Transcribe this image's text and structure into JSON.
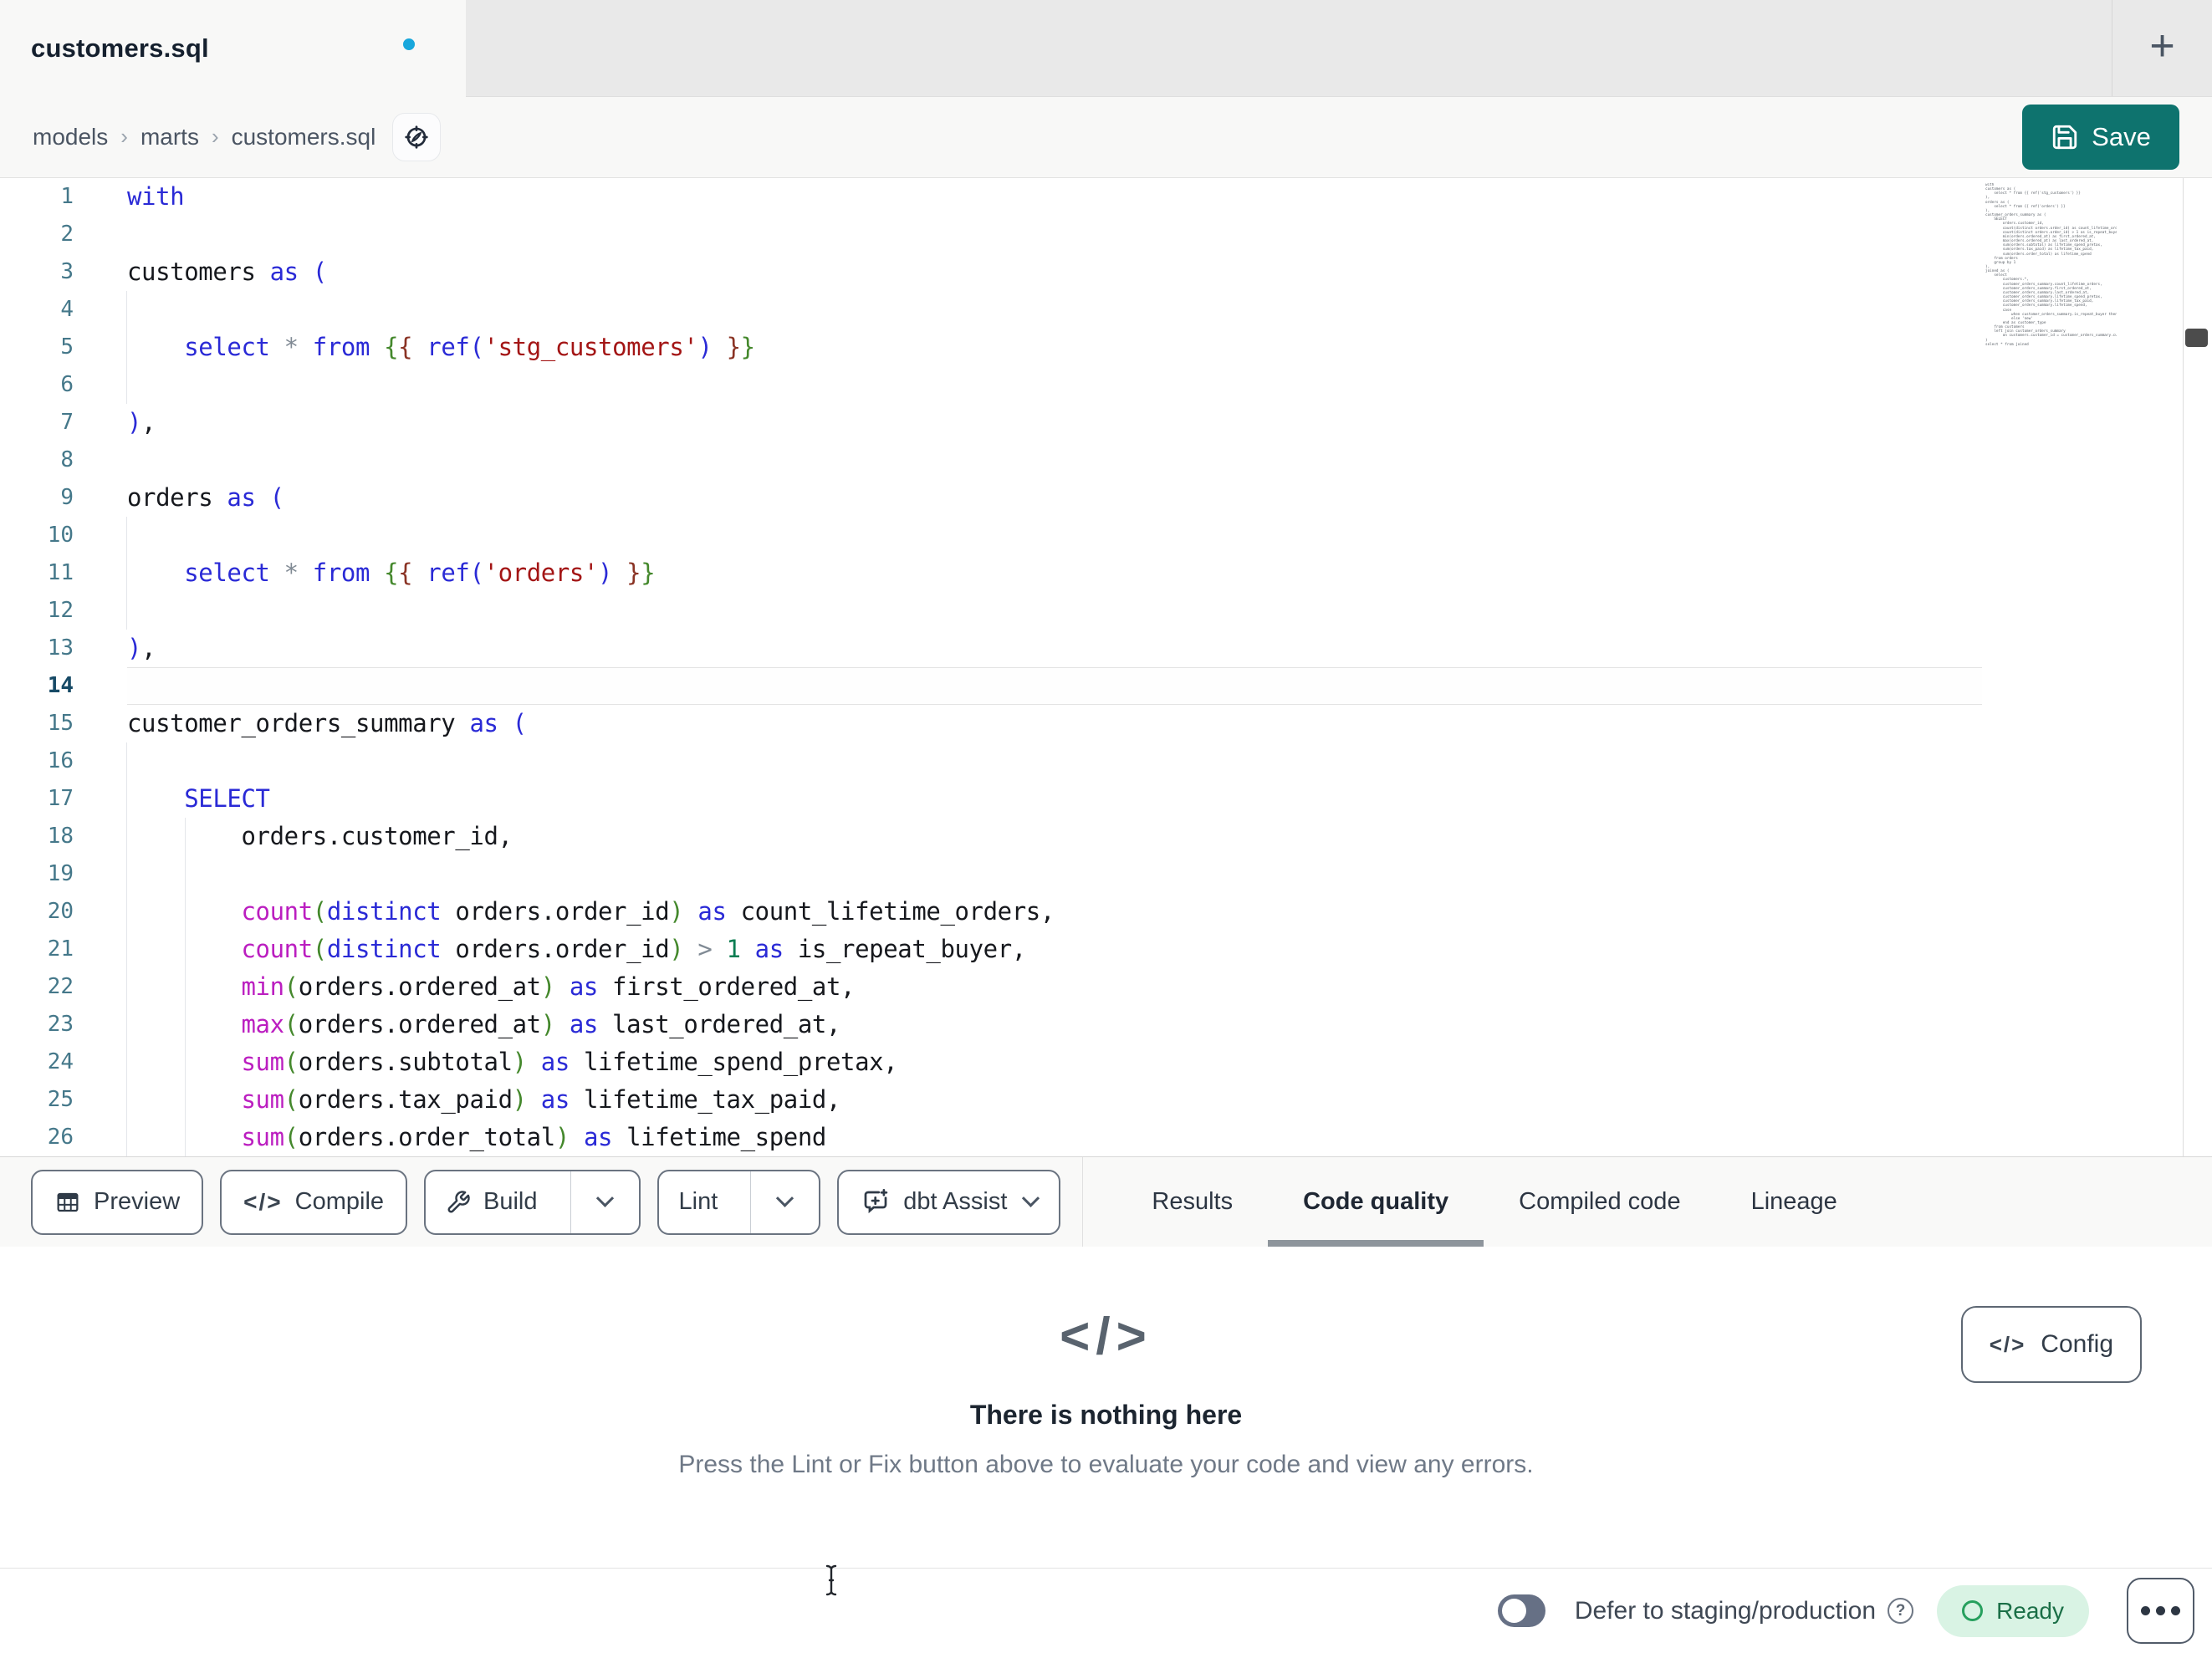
{
  "tab_bar": {
    "tab_title": "customers.sql",
    "new_tab_glyph": "+"
  },
  "breadcrumb": {
    "items": [
      "models",
      "marts",
      "customers.sql"
    ],
    "separator": "›"
  },
  "save_button": {
    "label": "Save"
  },
  "editor": {
    "active_line": 14,
    "lines": [
      {
        "n": 1,
        "tokens": [
          [
            "with",
            "k"
          ]
        ]
      },
      {
        "n": 2,
        "tokens": []
      },
      {
        "n": 3,
        "tokens": [
          [
            "customers "
          ],
          [
            "as",
            "k"
          ],
          [
            " "
          ],
          [
            "(",
            "p1"
          ]
        ]
      },
      {
        "n": 4,
        "guides": 1,
        "tokens": []
      },
      {
        "n": 5,
        "guides": 1,
        "tokens": [
          [
            "    "
          ],
          [
            "select",
            "k"
          ],
          [
            " "
          ],
          [
            "*",
            "o"
          ],
          [
            " "
          ],
          [
            "from",
            "k"
          ],
          [
            " "
          ],
          [
            "{",
            "p2"
          ],
          [
            "{",
            "p3"
          ],
          [
            " "
          ],
          [
            "ref",
            "k"
          ],
          [
            "(",
            "p1"
          ],
          [
            "'stg_customers'",
            "s"
          ],
          [
            ")",
            "p1"
          ],
          [
            " "
          ],
          [
            "}",
            "p3"
          ],
          [
            "}",
            "p2"
          ]
        ]
      },
      {
        "n": 6,
        "guides": 1,
        "tokens": []
      },
      {
        "n": 7,
        "tokens": [
          [
            ")",
            "p1"
          ],
          [
            ","
          ]
        ]
      },
      {
        "n": 8,
        "tokens": []
      },
      {
        "n": 9,
        "tokens": [
          [
            "orders "
          ],
          [
            "as",
            "k"
          ],
          [
            " "
          ],
          [
            "(",
            "p1"
          ]
        ]
      },
      {
        "n": 10,
        "guides": 1,
        "tokens": []
      },
      {
        "n": 11,
        "guides": 1,
        "tokens": [
          [
            "    "
          ],
          [
            "select",
            "k"
          ],
          [
            " "
          ],
          [
            "*",
            "o"
          ],
          [
            " "
          ],
          [
            "from",
            "k"
          ],
          [
            " "
          ],
          [
            "{",
            "p2"
          ],
          [
            "{",
            "p3"
          ],
          [
            " "
          ],
          [
            "ref",
            "k"
          ],
          [
            "(",
            "p1"
          ],
          [
            "'orders'",
            "s"
          ],
          [
            ")",
            "p1"
          ],
          [
            " "
          ],
          [
            "}",
            "p3"
          ],
          [
            "}",
            "p2"
          ]
        ]
      },
      {
        "n": 12,
        "guides": 1,
        "tokens": []
      },
      {
        "n": 13,
        "tokens": [
          [
            ")",
            "p1"
          ],
          [
            ","
          ]
        ]
      },
      {
        "n": 14,
        "tokens": []
      },
      {
        "n": 15,
        "tokens": [
          [
            "customer_orders_summary "
          ],
          [
            "as",
            "k"
          ],
          [
            " "
          ],
          [
            "(",
            "p1"
          ]
        ]
      },
      {
        "n": 16,
        "guides": 1,
        "tokens": []
      },
      {
        "n": 17,
        "guides": 1,
        "tokens": [
          [
            "    "
          ],
          [
            "SELECT",
            "k"
          ]
        ]
      },
      {
        "n": 18,
        "guides": 2,
        "tokens": [
          [
            "        orders.customer_id,"
          ]
        ]
      },
      {
        "n": 19,
        "guides": 2,
        "tokens": []
      },
      {
        "n": 20,
        "guides": 2,
        "tokens": [
          [
            "        "
          ],
          [
            "count",
            "f"
          ],
          [
            "(",
            "p2"
          ],
          [
            "distinct",
            "k"
          ],
          [
            " orders.order_id"
          ],
          [
            ")",
            "p2"
          ],
          [
            " "
          ],
          [
            "as",
            "k"
          ],
          [
            " count_lifetime_orders,"
          ]
        ]
      },
      {
        "n": 21,
        "guides": 2,
        "tokens": [
          [
            "        "
          ],
          [
            "count",
            "f"
          ],
          [
            "(",
            "p2"
          ],
          [
            "distinct",
            "k"
          ],
          [
            " orders.order_id"
          ],
          [
            ")",
            "p2"
          ],
          [
            " "
          ],
          [
            ">",
            "o"
          ],
          [
            " "
          ],
          [
            "1",
            "n"
          ],
          [
            " "
          ],
          [
            "as",
            "k"
          ],
          [
            " is_repeat_buyer,"
          ]
        ]
      },
      {
        "n": 22,
        "guides": 2,
        "tokens": [
          [
            "        "
          ],
          [
            "min",
            "f"
          ],
          [
            "(",
            "p2"
          ],
          [
            "orders.ordered_at"
          ],
          [
            ")",
            "p2"
          ],
          [
            " "
          ],
          [
            "as",
            "k"
          ],
          [
            " first_ordered_at,"
          ]
        ]
      },
      {
        "n": 23,
        "guides": 2,
        "tokens": [
          [
            "        "
          ],
          [
            "max",
            "f"
          ],
          [
            "(",
            "p2"
          ],
          [
            "orders.ordered_at"
          ],
          [
            ")",
            "p2"
          ],
          [
            " "
          ],
          [
            "as",
            "k"
          ],
          [
            " last_ordered_at,"
          ]
        ]
      },
      {
        "n": 24,
        "guides": 2,
        "tokens": [
          [
            "        "
          ],
          [
            "sum",
            "f"
          ],
          [
            "(",
            "p2"
          ],
          [
            "orders.subtotal"
          ],
          [
            ")",
            "p2"
          ],
          [
            " "
          ],
          [
            "as",
            "k"
          ],
          [
            " lifetime_spend_pretax,"
          ]
        ]
      },
      {
        "n": 25,
        "guides": 2,
        "tokens": [
          [
            "        "
          ],
          [
            "sum",
            "f"
          ],
          [
            "(",
            "p2"
          ],
          [
            "orders.tax_paid"
          ],
          [
            ")",
            "p2"
          ],
          [
            " "
          ],
          [
            "as",
            "k"
          ],
          [
            " lifetime_tax_paid,"
          ]
        ]
      },
      {
        "n": 26,
        "guides": 2,
        "tokens": [
          [
            "        "
          ],
          [
            "sum",
            "f"
          ],
          [
            "(",
            "p2"
          ],
          [
            "orders.order_total"
          ],
          [
            ")",
            "p2"
          ],
          [
            " "
          ],
          [
            "as",
            "k"
          ],
          [
            " lifetime_spend"
          ]
        ]
      }
    ]
  },
  "minimap_lines": [
    "with",
    "",
    "customers as (",
    "",
    "    select * from {{ ref('stg_customers') }}",
    "",
    "),",
    "",
    "orders as (",
    "",
    "    select * from {{ ref('orders') }}",
    "",
    "),",
    "",
    "customer_orders_summary as (",
    "",
    "    SELECT",
    "        orders.customer_id,",
    "",
    "        count(distinct orders.order_id) as count_lifetime_orders,",
    "        count(distinct orders.order_id) > 1 as is_repeat_buyer,",
    "        min(orders.ordered_at) as first_ordered_at,",
    "        max(orders.ordered_at) as last_ordered_at,",
    "        sum(orders.subtotal) as lifetime_spend_pretax,",
    "        sum(orders.tax_paid) as lifetime_tax_paid,",
    "        sum(orders.order_total) as lifetime_spend",
    "",
    "    from orders",
    "",
    "    group by 1",
    "",
    "),",
    "",
    "joined as (",
    "",
    "    select",
    "        customers.*,",
    "",
    "        customer_orders_summary.count_lifetime_orders,",
    "        customer_orders_summary.first_ordered_at,",
    "        customer_orders_summary.last_ordered_at,",
    "        customer_orders_summary.lifetime_spend_pretax,",
    "        customer_orders_summary.lifetime_tax_paid,",
    "        customer_orders_summary.lifetime_spend,",
    "",
    "        case",
    "            when customer_orders_summary.is_repeat_buyer then 'returning'",
    "            else 'new'",
    "        end as customer_type",
    "",
    "    from customers",
    "",
    "    left join customer_orders_summary",
    "        on customers.customer_id = customer_orders_summary.customer_id",
    "",
    ")",
    "",
    "select * from joined"
  ],
  "toolbar": {
    "preview_label": "Preview",
    "compile_label": "Compile",
    "compile_icon_glyph": "</>",
    "build_label": "Build",
    "lint_label": "Lint",
    "assist_label": "dbt Assist"
  },
  "panel_tabs": [
    {
      "label": "Results",
      "active": false
    },
    {
      "label": "Code quality",
      "active": true
    },
    {
      "label": "Compiled code",
      "active": false
    },
    {
      "label": "Lineage",
      "active": false
    }
  ],
  "empty_state": {
    "icon_glyph": "</>",
    "title": "There is nothing here",
    "subtitle": "Press the Lint or Fix button above to evaluate your code and view any errors.",
    "config_label": "Config",
    "config_icon_glyph": "</>"
  },
  "status_bar": {
    "defer_label": "Defer to staging/production",
    "help_glyph": "?",
    "ready_label": "Ready"
  },
  "colors": {
    "accent_teal": "#0e736e",
    "unsaved_dot": "#18a7dc",
    "keyword": "#2a2ad6",
    "function": "#bb1ec0",
    "string": "#a31515",
    "number": "#0b7d52",
    "operator": "#808a94",
    "bracket1": "#2a2ad6",
    "bracket2": "#44882c",
    "bracket3": "#8a3324",
    "line_number": "#45788a",
    "active_line_number": "#174a66",
    "tab_underline": "#8e959c",
    "toggle_track": "#667085",
    "ready_bg": "#d9f3e4",
    "ready_text": "#1b6f47",
    "ready_ring": "#27a05e"
  }
}
